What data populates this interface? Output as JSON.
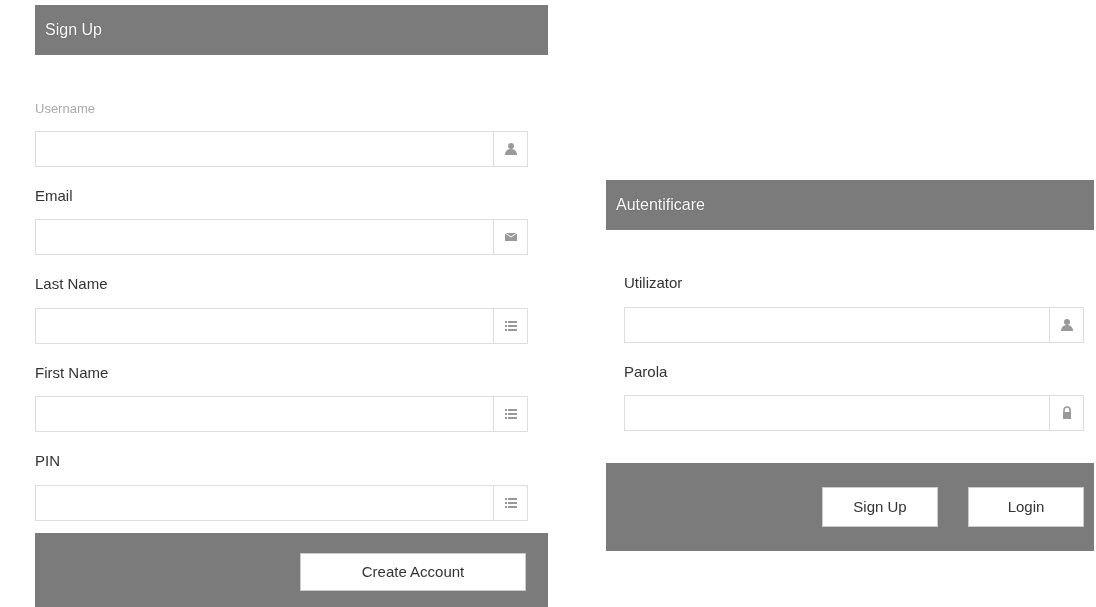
{
  "panels": [
    {
      "title": "Sign Up",
      "fields": [
        {
          "label": "Username",
          "muted": true,
          "kind": "user"
        },
        {
          "label": "Email",
          "muted": false,
          "kind": "email"
        },
        {
          "label": "Last Name",
          "muted": false,
          "kind": "text"
        },
        {
          "label": "First Name",
          "muted": false,
          "kind": "text"
        },
        {
          "label": "PIN",
          "muted": false,
          "kind": "text"
        }
      ],
      "buttons": [
        "Create Account"
      ]
    },
    {
      "title": "Autentificare",
      "fields": [
        {
          "label": "Utilizator",
          "muted": false,
          "kind": "user"
        },
        {
          "label": "Parola",
          "muted": false,
          "kind": "password"
        }
      ],
      "buttons": [
        "Sign Up",
        "Login"
      ]
    }
  ]
}
